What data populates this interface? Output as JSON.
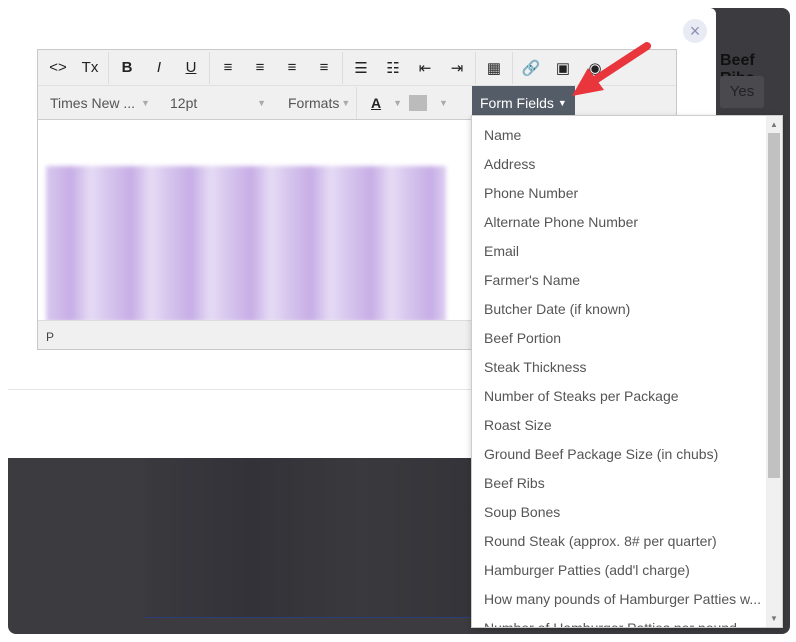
{
  "background": {
    "title": "Beef Ribs",
    "yes_label": "Yes"
  },
  "toolbar": {
    "row1": [
      {
        "icon": "source-code-icon",
        "glyph": "<>"
      },
      {
        "icon": "clear-format-icon",
        "glyph": "Tx"
      },
      {
        "icon": "bold-icon",
        "glyph": "B"
      },
      {
        "icon": "italic-icon",
        "glyph": "I"
      },
      {
        "icon": "underline-icon",
        "glyph": "U"
      },
      {
        "icon": "align-left-icon",
        "glyph": "≡"
      },
      {
        "icon": "align-center-icon",
        "glyph": "≡"
      },
      {
        "icon": "align-right-icon",
        "glyph": "≡"
      },
      {
        "icon": "justify-icon",
        "glyph": "≡"
      },
      {
        "icon": "bullet-list-icon",
        "glyph": "☰"
      },
      {
        "icon": "numbered-list-icon",
        "glyph": "☷"
      },
      {
        "icon": "outdent-icon",
        "glyph": "⇤"
      },
      {
        "icon": "indent-icon",
        "glyph": "⇥"
      },
      {
        "icon": "table-icon",
        "glyph": "▦"
      },
      {
        "icon": "link-icon",
        "glyph": "🔗"
      },
      {
        "icon": "image-icon",
        "glyph": "▣"
      },
      {
        "icon": "media-icon",
        "glyph": "◉"
      }
    ],
    "font_family": "Times New ...",
    "font_size": "12pt",
    "formats": "Formats",
    "text_color": "A",
    "form_fields": "Form Fields"
  },
  "editor": {
    "status_path": "P"
  },
  "dropdown": {
    "items": [
      "Name",
      "Address",
      "Phone Number",
      "Alternate Phone Number",
      "Email",
      "Farmer's Name",
      "Butcher Date (if known)",
      "Beef Portion",
      "Steak Thickness",
      "Number of Steaks per Package",
      "Roast Size",
      "Ground Beef Package Size (in chubs)",
      "Beef Ribs",
      "Soup Bones",
      "Round Steak (approx. 8# per quarter)",
      "Hamburger Patties (add'l charge)",
      "How many pounds of Hamburger Patties w...",
      "Number of Hamburger Patties per pound"
    ]
  },
  "colors": {
    "accent": "#545c67",
    "arrow": "#e8363c"
  }
}
